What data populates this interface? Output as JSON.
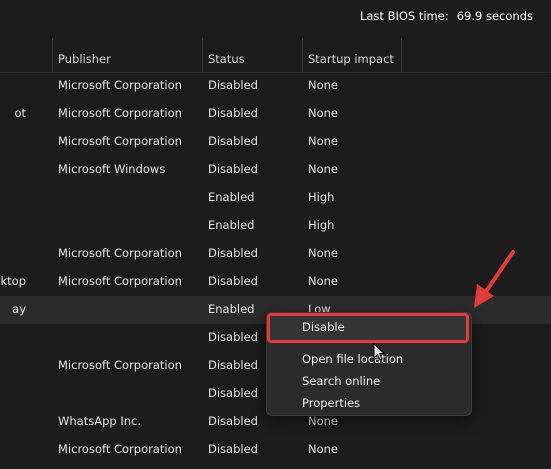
{
  "bios": {
    "label": "Last BIOS time:",
    "value": "69.9 seconds"
  },
  "columns": {
    "publisher": "Publisher",
    "status": "Status",
    "impact": "Startup impact"
  },
  "rows": [
    {
      "name": "",
      "publisher": "Microsoft Corporation",
      "status": "Disabled",
      "impact": "None"
    },
    {
      "name": "ot",
      "publisher": "Microsoft Corporation",
      "status": "Disabled",
      "impact": "None"
    },
    {
      "name": "",
      "publisher": "Microsoft Corporation",
      "status": "Disabled",
      "impact": "None"
    },
    {
      "name": "",
      "publisher": "Microsoft Windows",
      "status": "Disabled",
      "impact": "None"
    },
    {
      "name": "",
      "publisher": "",
      "status": "Enabled",
      "impact": "High"
    },
    {
      "name": "",
      "publisher": "",
      "status": "Enabled",
      "impact": "High"
    },
    {
      "name": "",
      "publisher": "Microsoft Corporation",
      "status": "Disabled",
      "impact": "None"
    },
    {
      "name": "sktop",
      "publisher": "Microsoft Corporation",
      "status": "Disabled",
      "impact": "None"
    },
    {
      "name": "ay",
      "publisher": "",
      "status": "Enabled",
      "impact": "Low"
    },
    {
      "name": "",
      "publisher": "",
      "status": "Disabled",
      "impact": ""
    },
    {
      "name": "",
      "publisher": "Microsoft Corporation",
      "status": "Disabled",
      "impact": ""
    },
    {
      "name": "",
      "publisher": "",
      "status": "Disabled",
      "impact": ""
    },
    {
      "name": "",
      "publisher": "WhatsApp Inc.",
      "status": "Disabled",
      "impact": "None"
    },
    {
      "name": "",
      "publisher": "Microsoft Corporation",
      "status": "Disabled",
      "impact": "None"
    }
  ],
  "selected_row": 8,
  "context_menu": {
    "items": [
      "Disable",
      "Open file location",
      "Search online",
      "Properties"
    ]
  },
  "colors": {
    "highlight": "#e5393c",
    "background": "#1c1c1c",
    "menu": "#2b2b2b"
  }
}
